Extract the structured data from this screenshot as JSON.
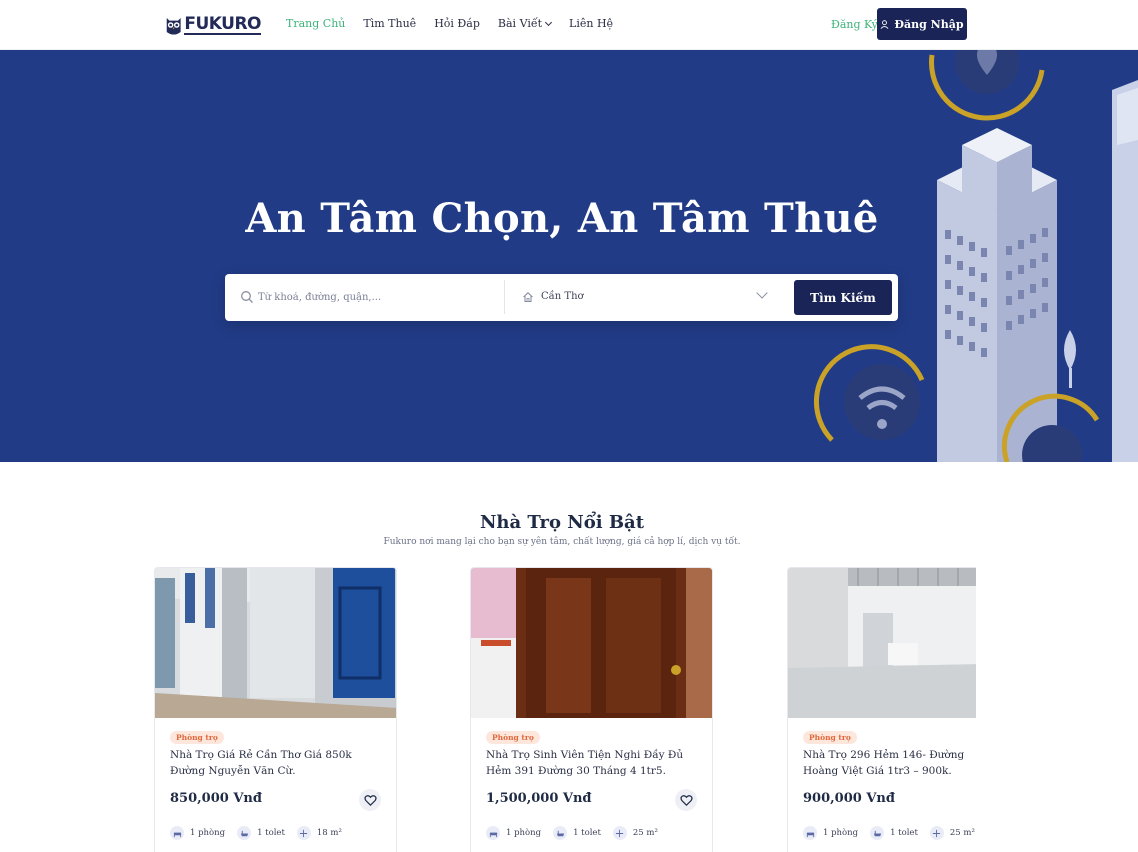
{
  "brand": {
    "name": "FUKURO"
  },
  "nav": {
    "items": [
      {
        "label": "Trang Chủ",
        "active": true
      },
      {
        "label": "Tìm Thuê"
      },
      {
        "label": "Hỏi Đáp"
      },
      {
        "label": "Bài Viết",
        "dropdown": true
      },
      {
        "label": "Liên Hệ"
      }
    ],
    "register_label": "Đăng Ký",
    "login_label": "Đăng Nhập"
  },
  "hero": {
    "title": "An Tâm Chọn, An Tâm Thuê",
    "search_placeholder": "Từ khoá, đường, quận,...",
    "city_value": "Cần Thơ",
    "search_button": "Tìm Kiếm"
  },
  "featured": {
    "title": "Nhà Trọ Nổi Bật",
    "subtitle": "Fukuro nơi mang lại cho bạn sự yên tâm, chất lượng, giá cả hợp lí, dịch vụ tốt.",
    "listings": [
      {
        "tag": "Phòng trọ",
        "title": "Nhà Trọ Giá Rẻ Cần Thơ Giá 850k Đường Nguyễn Văn Cừ.",
        "price": "850,000 Vnđ",
        "rooms": "1 phòng",
        "toilets": "1 tolet",
        "area": "18 m²"
      },
      {
        "tag": "Phòng trọ",
        "title": "Nhà Trọ Sinh Viên Tiện Nghi Đầy Đủ Hẻm 391 Đường 30 Tháng 4 1tr5.",
        "price": "1,500,000 Vnđ",
        "rooms": "1 phòng",
        "toilets": "1 tolet",
        "area": "25 m²"
      },
      {
        "tag": "Phòng trọ",
        "title": "Nhà Trọ 296 Hẻm 146- Đường Hoàng Việt Giá 1tr3 – 900k.",
        "price": "900,000 Vnđ",
        "rooms": "1 phòng",
        "toilets": "1 tolet",
        "area": "25 m²"
      }
    ]
  },
  "colors": {
    "primary_dark": "#1b2456",
    "hero_blue": "#213b86",
    "accent_green": "#3fb37a",
    "tag_orange": "#e0683b"
  }
}
